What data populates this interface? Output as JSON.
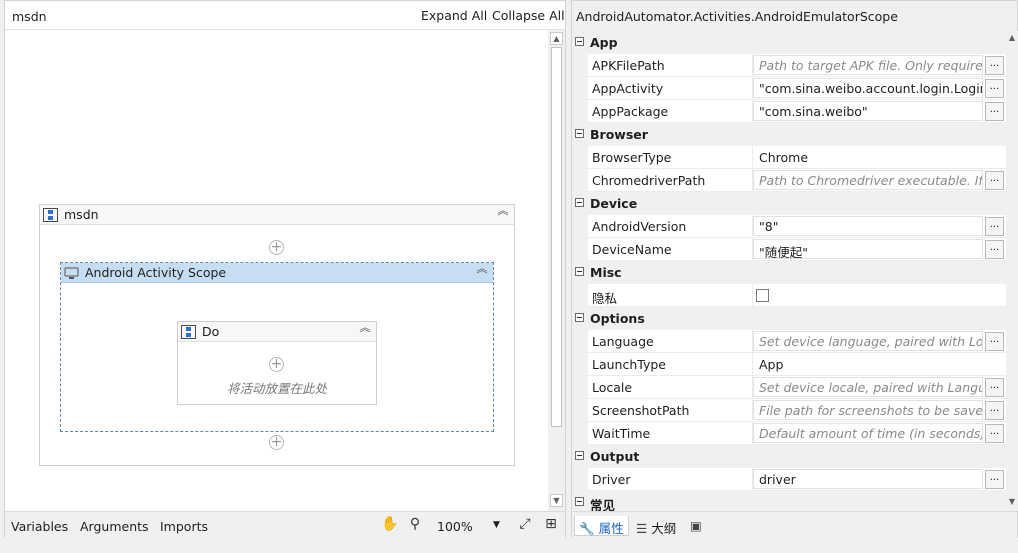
{
  "designer": {
    "title": "msdn",
    "expand_all": "Expand All",
    "collapse_all": "Collapse All",
    "sequence_title": "msdn",
    "scope_title": "Android Activity Scope",
    "do_title": "Do",
    "drop_hint": "将活动放置在此处",
    "footer": {
      "variables": "Variables",
      "arguments": "Arguments",
      "imports": "Imports",
      "zoom": "100%"
    }
  },
  "properties": {
    "title": "AndroidAutomator.Activities.AndroidEmulatorScope",
    "categories": [
      {
        "name": "App",
        "rows": [
          {
            "name": "APKFilePath",
            "value": "Path to target APK file. Only required i",
            "placeholder": true,
            "button": true
          },
          {
            "name": "AppActivity",
            "value": "\"com.sina.weibo.account.login.LoginAc",
            "placeholder": false,
            "button": true
          },
          {
            "name": "AppPackage",
            "value": "\"com.sina.weibo\"",
            "placeholder": false,
            "button": true
          }
        ]
      },
      {
        "name": "Browser",
        "rows": [
          {
            "name": "BrowserType",
            "value": "Chrome",
            "placeholder": false,
            "button": false,
            "plain": true
          },
          {
            "name": "ChromedriverPath",
            "value": "Path to Chromedriver executable. If no",
            "placeholder": true,
            "button": true
          }
        ]
      },
      {
        "name": "Device",
        "rows": [
          {
            "name": "AndroidVersion",
            "value": "\"8\"",
            "placeholder": false,
            "button": true
          },
          {
            "name": "DeviceName",
            "value": "\"随便起\"",
            "placeholder": false,
            "button": true
          }
        ]
      },
      {
        "name": "Misc",
        "rows": [
          {
            "name": "隐私",
            "value": "",
            "checkbox": true,
            "button": false
          }
        ]
      },
      {
        "name": "Options",
        "rows": [
          {
            "name": "Language",
            "value": "Set device language, paired with Local",
            "placeholder": true,
            "button": true
          },
          {
            "name": "LaunchType",
            "value": "App",
            "placeholder": false,
            "button": false,
            "plain": true
          },
          {
            "name": "Locale",
            "value": "Set device locale, paired with Languag",
            "placeholder": true,
            "button": true
          },
          {
            "name": "ScreenshotPath",
            "value": "File path for screenshots to be saved ir",
            "placeholder": true,
            "button": true
          },
          {
            "name": "WaitTime",
            "value": "Default amount of time (in seconds) th",
            "placeholder": true,
            "button": true
          }
        ]
      },
      {
        "name": "Output",
        "rows": [
          {
            "name": "Driver",
            "value": "driver",
            "placeholder": false,
            "button": true
          }
        ]
      },
      {
        "name": "常见",
        "rows": []
      }
    ],
    "tabs": {
      "properties": "属性",
      "outline": "大纲"
    }
  },
  "colors": {
    "scope_header": "#c7def2",
    "accent": "#1a64c8"
  }
}
